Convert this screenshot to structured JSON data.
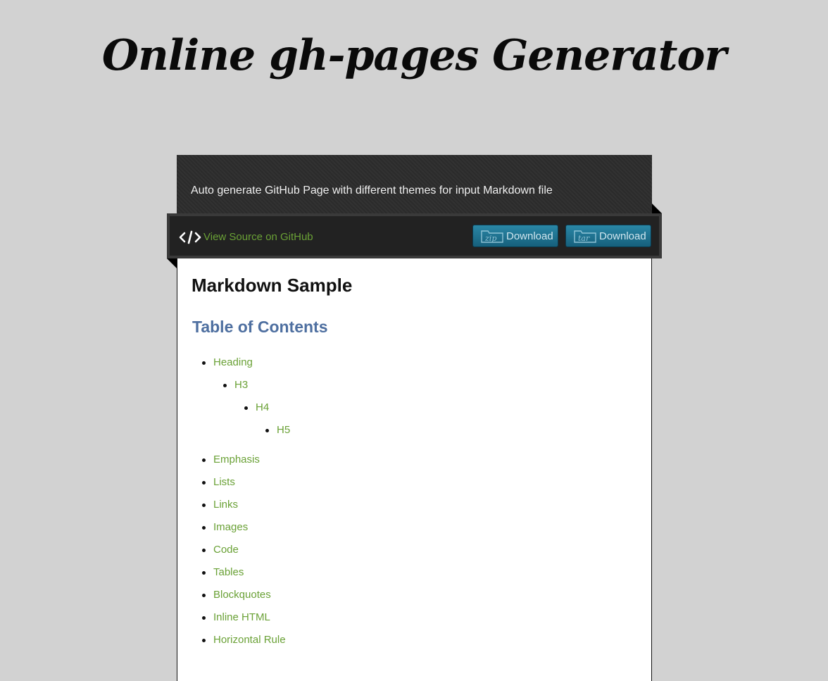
{
  "site": {
    "title": "Online gh-pages Generator"
  },
  "header": {
    "tagline": "Auto generate GitHub Page with different themes for input Markdown file"
  },
  "toolbar": {
    "source_link": "View Source on GitHub",
    "download_zip": "Download",
    "download_tar": "Download",
    "zip_icon_text": "zip",
    "tar_icon_text": "tar"
  },
  "content": {
    "h1": "Markdown Sample",
    "toc_title": "Table of Contents",
    "toc": [
      {
        "label": "Heading",
        "level": 1
      },
      {
        "label": "H3",
        "level": 2
      },
      {
        "label": "H4",
        "level": 3
      },
      {
        "label": "H5",
        "level": 4
      },
      {
        "label": "Emphasis",
        "level": 1
      },
      {
        "label": "Lists",
        "level": 1
      },
      {
        "label": "Links",
        "level": 1
      },
      {
        "label": "Images",
        "level": 1
      },
      {
        "label": "Code",
        "level": 1
      },
      {
        "label": "Tables",
        "level": 1
      },
      {
        "label": "Blockquotes",
        "level": 1
      },
      {
        "label": "Inline HTML",
        "level": 1
      },
      {
        "label": "Horizontal Rule",
        "level": 1
      }
    ]
  },
  "colors": {
    "background": "#d2d2d2",
    "link": "#6aa136",
    "toc_heading": "#4e6fa0",
    "button": "#1f7596"
  }
}
